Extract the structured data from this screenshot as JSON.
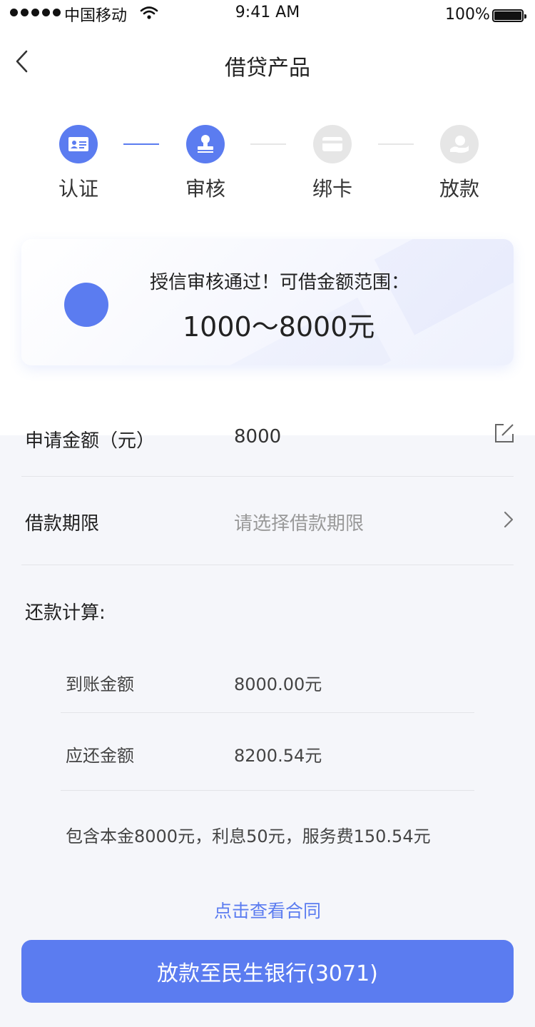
{
  "status_bar": {
    "carrier": "中国移动",
    "time": "9:41 AM",
    "battery": "100%"
  },
  "nav": {
    "title": "借贷产品",
    "back_icon": "chevron-left-icon"
  },
  "steps": [
    {
      "label": "认证",
      "icon": "id-card-icon",
      "state": "done"
    },
    {
      "label": "审核",
      "icon": "stamp-icon",
      "state": "active"
    },
    {
      "label": "绑卡",
      "icon": "bank-card-icon",
      "state": "pending"
    },
    {
      "label": "放款",
      "icon": "hand-coin-icon",
      "state": "pending"
    }
  ],
  "credit_card": {
    "title": "授信审核通过！可借金额范围：",
    "range": "1000～8000元"
  },
  "form": {
    "amount_label": "申请金额（元）",
    "amount_value": "8000",
    "term_label": "借款期限",
    "term_placeholder": "请选择借款期限",
    "repay_title": "还款计算:"
  },
  "repayment": {
    "received_label": "到账金额",
    "received_value": "8000.00元",
    "due_label": "应还金额",
    "due_value": "8200.54元",
    "breakdown": "包含本金8000元，利息50元，服务费150.54元"
  },
  "contract_link": "点击查看合同",
  "submit_button": "放款至民生银行(3071)",
  "colors": {
    "accent": "#5b7cf0",
    "inactive": "#e6e6e6",
    "form_bg": "#f5f6fa"
  }
}
